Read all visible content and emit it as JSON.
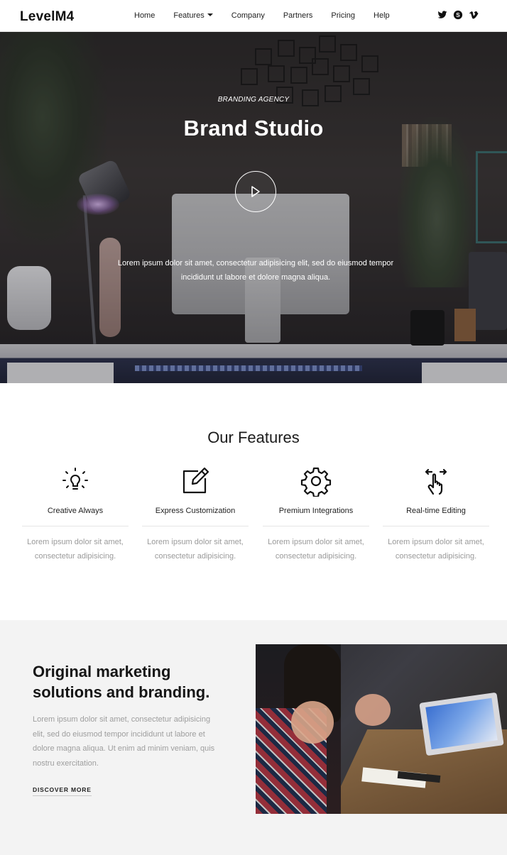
{
  "nav": {
    "logo": "LevelM4",
    "items": [
      "Home",
      "Features",
      "Company",
      "Partners",
      "Pricing",
      "Help"
    ],
    "social_icons": [
      "twitter-icon",
      "skype-icon",
      "vimeo-icon"
    ]
  },
  "hero": {
    "subtitle": "BRANDING AGENCY",
    "title": "Brand Studio",
    "text": "Lorem ipsum dolor sit amet, consectetur adipisicing elit, sed do eiusmod tempor incididunt ut labore et dolore magna aliqua."
  },
  "features": {
    "title": "Our Features",
    "items": [
      {
        "name": "Creative Always",
        "icon": "lightbulb-icon",
        "desc": "Lorem ipsum dolor sit amet, consectetur adipisicing."
      },
      {
        "name": "Express Customization",
        "icon": "edit-icon",
        "desc": "Lorem ipsum dolor sit amet, consectetur adipisicing."
      },
      {
        "name": "Premium Integrations",
        "icon": "gear-icon",
        "desc": "Lorem ipsum dolor sit amet, consectetur adipisicing."
      },
      {
        "name": "Real-time Editing",
        "icon": "touch-swipe-icon",
        "desc": "Lorem ipsum dolor sit amet, consectetur adipisicing."
      }
    ]
  },
  "marketing": {
    "title": "Original marketing solutions and branding.",
    "text": "Lorem ipsum dolor sit amet, consectetur adipisicing elit, sed do eiusmod tempor incididunt ut labore et dolore magna aliqua. Ut enim ad minim veniam, quis nostru exercitation.",
    "button": "DISCOVER MORE"
  },
  "colors": {
    "text_dark": "#151515",
    "text_muted": "#9a9a9a",
    "section_bg": "#f3f3f3"
  }
}
